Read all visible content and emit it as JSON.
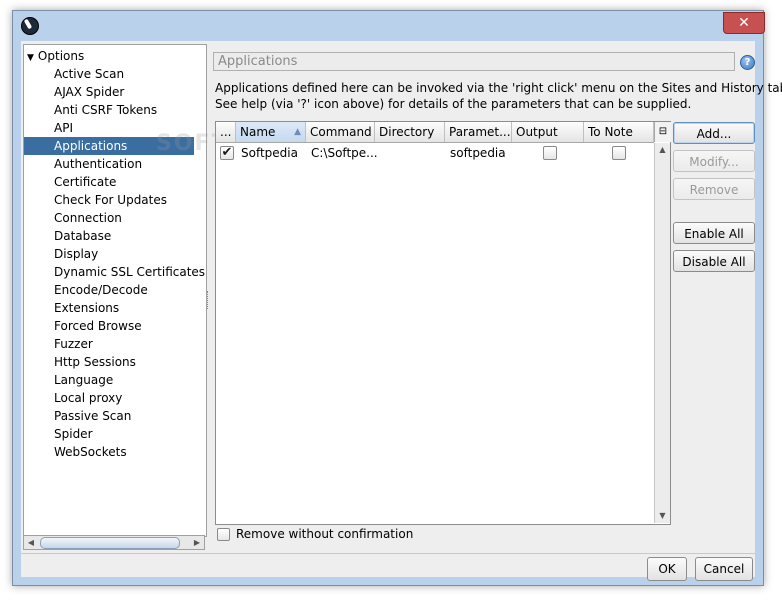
{
  "window": {
    "close_glyph": "✕"
  },
  "tree": {
    "root_label": "Options",
    "items": [
      "Active Scan",
      "AJAX Spider",
      "Anti CSRF Tokens",
      "API",
      "Applications",
      "Authentication",
      "Certificate",
      "Check For Updates",
      "Connection",
      "Database",
      "Display",
      "Dynamic SSL Certificates",
      "Encode/Decode",
      "Extensions",
      "Forced Browse",
      "Fuzzer",
      "Http Sessions",
      "Language",
      "Local proxy",
      "Passive Scan",
      "Spider",
      "WebSockets"
    ],
    "selected": "Applications"
  },
  "panel": {
    "title": "Applications",
    "help_glyph": "?",
    "desc_line1": "Applications defined here can be invoked via the 'right click' menu on the Sites and History tabs.",
    "desc_line2": "See help (via '?' icon above) for details of the parameters that can be supplied."
  },
  "table": {
    "columns": [
      "...",
      "Name",
      "Command",
      "Directory",
      "Paramet...",
      "Output",
      "To Note"
    ],
    "rows": [
      {
        "enabled": true,
        "name": "Softpedia",
        "command": "C:\\Softpe...",
        "directory": "",
        "parameters": "softpedia",
        "output": false,
        "to_note": false
      }
    ]
  },
  "buttons": {
    "add": "Add...",
    "modify": "Modify...",
    "remove": "Remove",
    "enable_all": "Enable All",
    "disable_all": "Disable All",
    "ok": "OK",
    "cancel": "Cancel"
  },
  "remove_without_confirmation": {
    "label": "Remove without confirmation",
    "checked": false
  },
  "watermark": "SOFTPEDIA"
}
